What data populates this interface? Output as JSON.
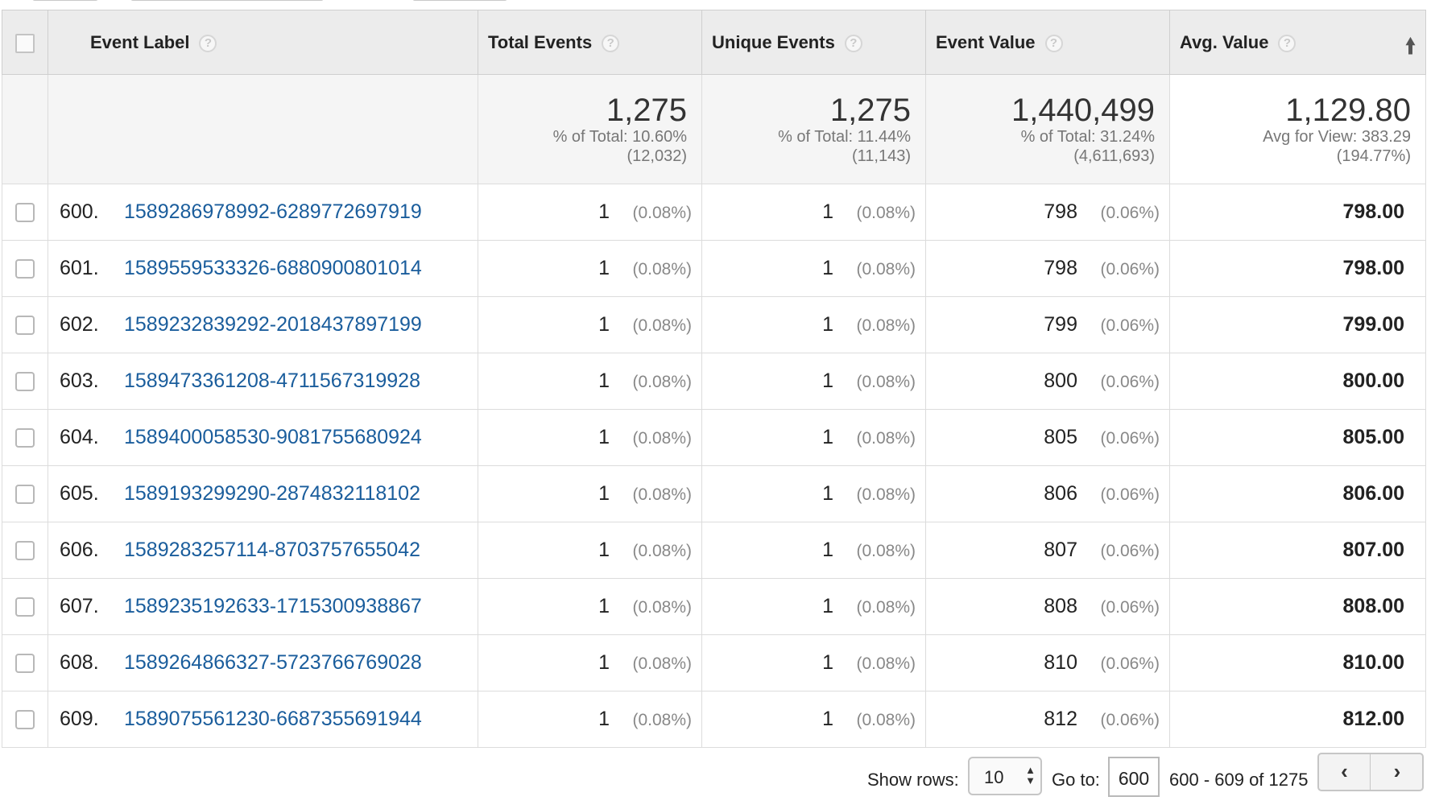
{
  "table": {
    "headers": {
      "label": "Event Label",
      "total": "Total Events",
      "unique": "Unique Events",
      "value": "Event Value",
      "avg": "Avg. Value"
    },
    "totals": {
      "total": {
        "main": "1,275",
        "line1": "% of Total: 10.60%",
        "line2": "(12,032)"
      },
      "unique": {
        "main": "1,275",
        "line1": "% of Total: 11.44%",
        "line2": "(11,143)"
      },
      "value": {
        "main": "1,440,499",
        "line1": "% of Total: 31.24%",
        "line2": "(4,611,693)"
      },
      "avg": {
        "main": "1,129.80",
        "line1": "Avg for View: 383.29",
        "line2": "(194.77%)"
      }
    },
    "rows": [
      {
        "index": "600.",
        "label": "1589286978992-6289772697919",
        "total": "1",
        "total_pct": "(0.08%)",
        "unique": "1",
        "unique_pct": "(0.08%)",
        "value": "798",
        "value_pct": "(0.06%)",
        "avg": "798.00"
      },
      {
        "index": "601.",
        "label": "1589559533326-6880900801014",
        "total": "1",
        "total_pct": "(0.08%)",
        "unique": "1",
        "unique_pct": "(0.08%)",
        "value": "798",
        "value_pct": "(0.06%)",
        "avg": "798.00"
      },
      {
        "index": "602.",
        "label": "1589232839292-2018437897199",
        "total": "1",
        "total_pct": "(0.08%)",
        "unique": "1",
        "unique_pct": "(0.08%)",
        "value": "799",
        "value_pct": "(0.06%)",
        "avg": "799.00"
      },
      {
        "index": "603.",
        "label": "1589473361208-4711567319928",
        "total": "1",
        "total_pct": "(0.08%)",
        "unique": "1",
        "unique_pct": "(0.08%)",
        "value": "800",
        "value_pct": "(0.06%)",
        "avg": "800.00"
      },
      {
        "index": "604.",
        "label": "1589400058530-9081755680924",
        "total": "1",
        "total_pct": "(0.08%)",
        "unique": "1",
        "unique_pct": "(0.08%)",
        "value": "805",
        "value_pct": "(0.06%)",
        "avg": "805.00"
      },
      {
        "index": "605.",
        "label": "1589193299290-2874832118102",
        "total": "1",
        "total_pct": "(0.08%)",
        "unique": "1",
        "unique_pct": "(0.08%)",
        "value": "806",
        "value_pct": "(0.06%)",
        "avg": "806.00"
      },
      {
        "index": "606.",
        "label": "1589283257114-8703757655042",
        "total": "1",
        "total_pct": "(0.08%)",
        "unique": "1",
        "unique_pct": "(0.08%)",
        "value": "807",
        "value_pct": "(0.06%)",
        "avg": "807.00"
      },
      {
        "index": "607.",
        "label": "1589235192633-1715300938867",
        "total": "1",
        "total_pct": "(0.08%)",
        "unique": "1",
        "unique_pct": "(0.08%)",
        "value": "808",
        "value_pct": "(0.06%)",
        "avg": "808.00"
      },
      {
        "index": "608.",
        "label": "1589264866327-5723766769028",
        "total": "1",
        "total_pct": "(0.08%)",
        "unique": "1",
        "unique_pct": "(0.08%)",
        "value": "810",
        "value_pct": "(0.06%)",
        "avg": "810.00"
      },
      {
        "index": "609.",
        "label": "1589075561230-6687355691944",
        "total": "1",
        "total_pct": "(0.08%)",
        "unique": "1",
        "unique_pct": "(0.08%)",
        "value": "812",
        "value_pct": "(0.06%)",
        "avg": "812.00"
      }
    ]
  },
  "pagination": {
    "show_rows_label": "Show rows:",
    "show_rows_value": "10",
    "goto_label": "Go to:",
    "goto_value": "600",
    "range_text": "600 - 609 of 1275"
  },
  "icons": {
    "help": "question-circle",
    "sort": "arrow-up",
    "prev": "chevron-left",
    "next": "chevron-right"
  },
  "colors": {
    "link": "#1a5d9c",
    "header_bg": "#ececec",
    "totals_bg": "#f5f5f5"
  }
}
